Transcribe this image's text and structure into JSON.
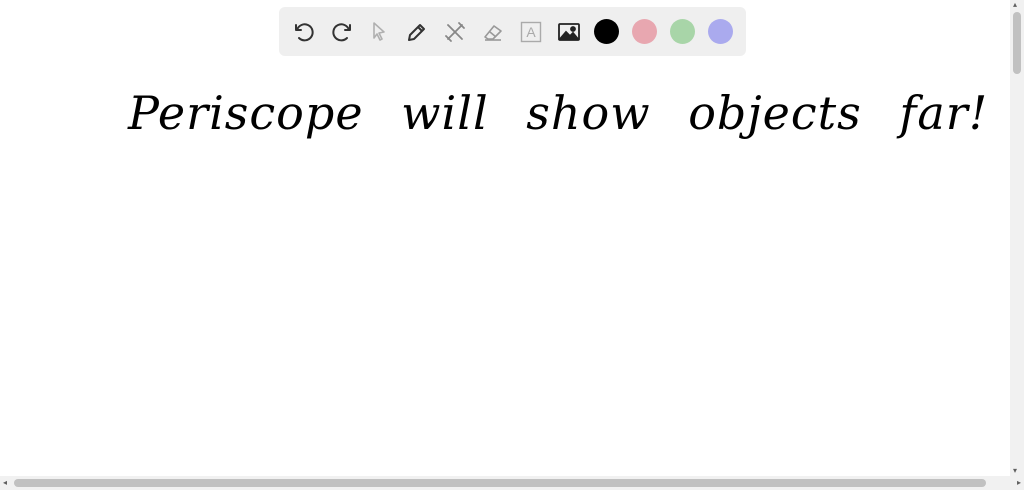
{
  "toolbar": {
    "tools": [
      {
        "icon": "undo-icon"
      },
      {
        "icon": "redo-icon"
      },
      {
        "icon": "pointer-icon"
      },
      {
        "icon": "pencil-icon"
      },
      {
        "icon": "tools-icon"
      },
      {
        "icon": "eraser-icon"
      },
      {
        "icon": "text-tool-icon",
        "glyph": "A"
      },
      {
        "icon": "image-icon"
      }
    ],
    "colors": [
      "#000000",
      "#e8a7b0",
      "#a8d5a8",
      "#aaaaee"
    ]
  },
  "canvas": {
    "handwriting": "Periscope will show objects far!"
  },
  "scrollbars": {
    "left_arrow": "◂",
    "right_arrow": "▸",
    "up_arrow": "▴",
    "down_arrow": "▾"
  }
}
